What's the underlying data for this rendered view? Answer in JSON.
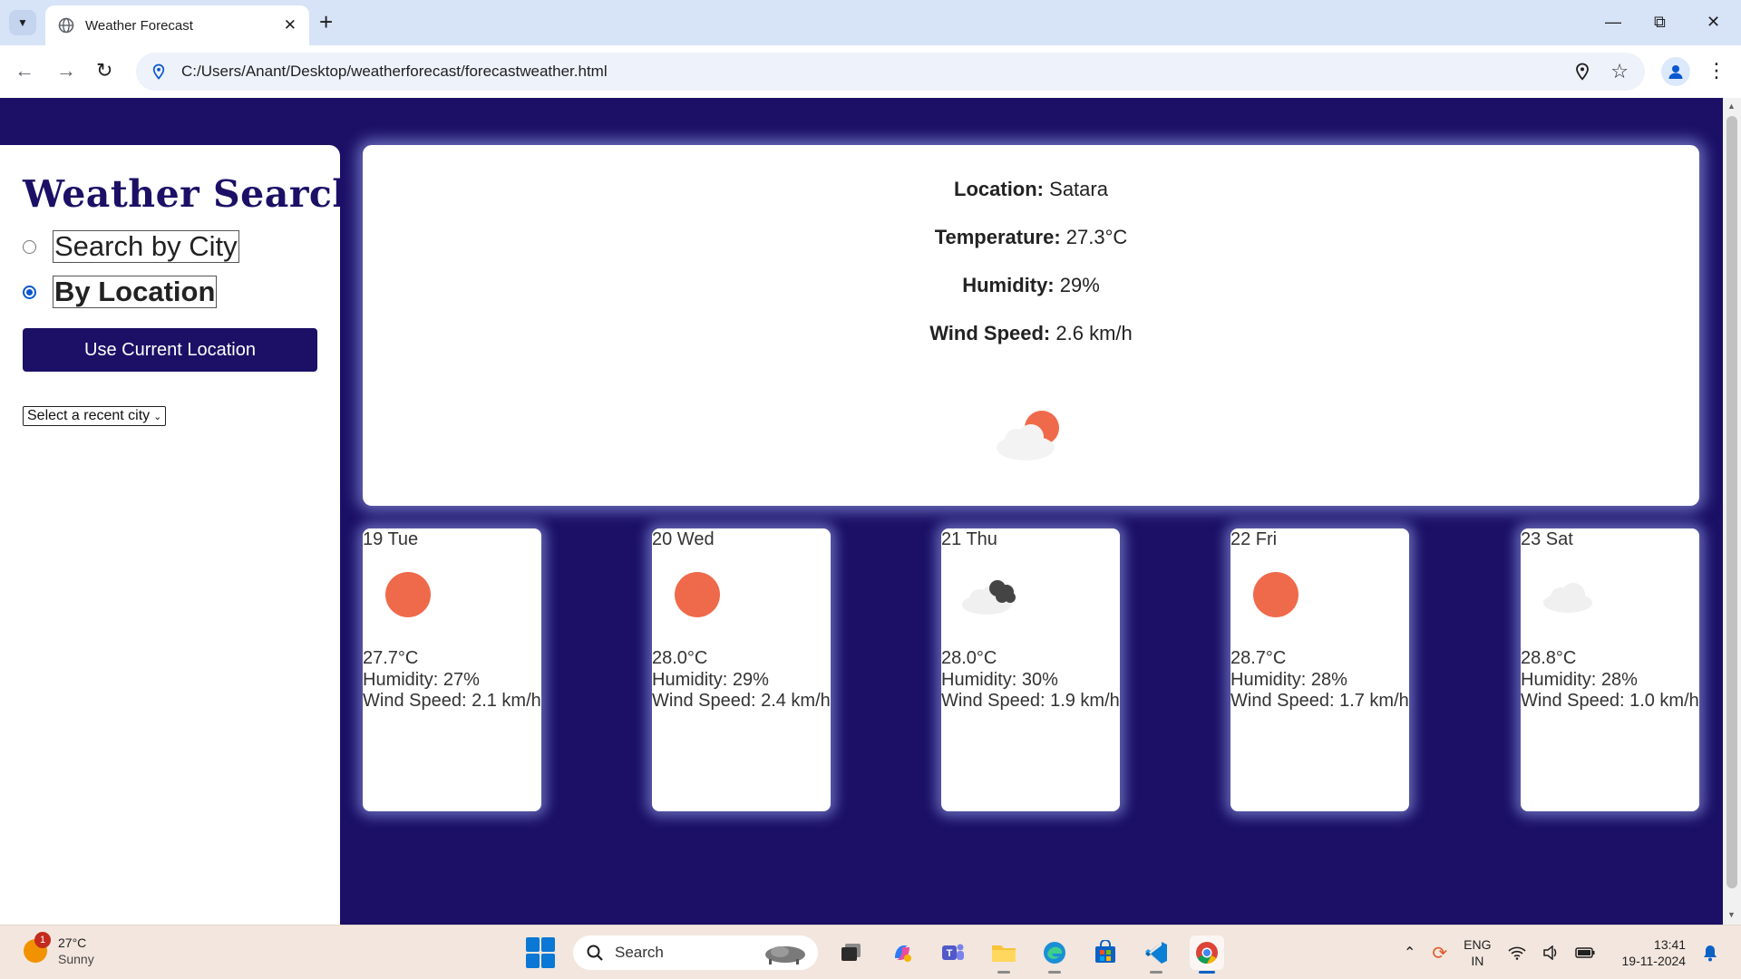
{
  "browser": {
    "tab_title": "Weather Forecast",
    "url": "C:/Users/Anant/Desktop/weatherforecast/forecastweather.html"
  },
  "sidebar": {
    "title": "Weather Search",
    "option_city": "Search by City",
    "option_location": "By Location",
    "selected_option": "By Location",
    "location_button": "Use Current Location",
    "recent_select": "Select a recent city"
  },
  "current": {
    "location_label": "Location:",
    "location": "Satara",
    "temperature_label": "Temperature:",
    "temperature": "27.3°C",
    "humidity_label": "Humidity:",
    "humidity": "29%",
    "wind_label": "Wind Speed:",
    "wind": "2.6 km/h",
    "icon": "partly-cloudy-day-icon"
  },
  "forecast": [
    {
      "date": "19 Tue",
      "temp": "27.7°C",
      "humidity": "Humidity: 27%",
      "wind": "Wind Speed: 2.1 km/h",
      "icon": "sun-icon"
    },
    {
      "date": "20 Wed",
      "temp": "28.0°C",
      "humidity": "Humidity: 29%",
      "wind": "Wind Speed: 2.4 km/h",
      "icon": "sun-icon"
    },
    {
      "date": "21 Thu",
      "temp": "28.0°C",
      "humidity": "Humidity: 30%",
      "wind": "Wind Speed: 1.9 km/h",
      "icon": "broken-clouds-icon"
    },
    {
      "date": "22 Fri",
      "temp": "28.7°C",
      "humidity": "Humidity: 28%",
      "wind": "Wind Speed: 1.7 km/h",
      "icon": "sun-icon"
    },
    {
      "date": "23 Sat",
      "temp": "28.8°C",
      "humidity": "Humidity: 28%",
      "wind": "Wind Speed: 1.0 km/h",
      "icon": "cloud-icon"
    }
  ],
  "taskbar": {
    "weather_temp": "27°C",
    "weather_desc": "Sunny",
    "weather_badge": "1",
    "search_label": "Search",
    "lang_top": "ENG",
    "lang_bottom": "IN",
    "time": "13:41",
    "date": "19-11-2024"
  },
  "colors": {
    "page_background": "#1b1066",
    "accent": "#1b1066",
    "sun": "#ef6a4a"
  }
}
